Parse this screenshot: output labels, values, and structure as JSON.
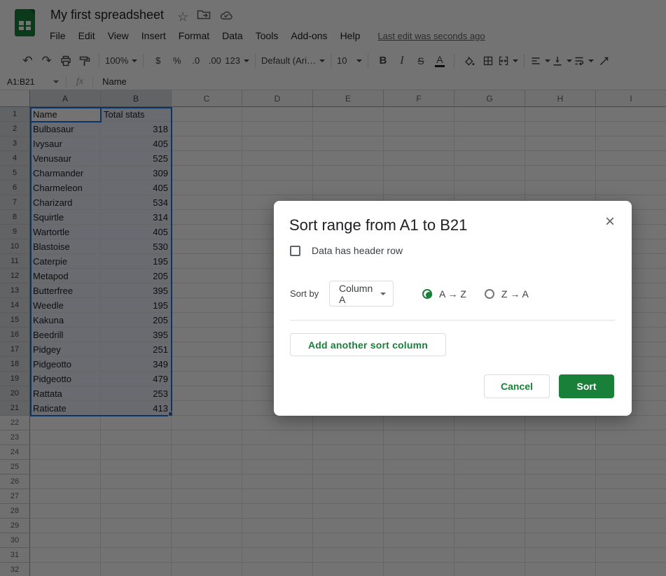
{
  "titlebar": {
    "title": "My first spreadsheet",
    "star_icon": "☆",
    "menu": [
      "File",
      "Edit",
      "View",
      "Insert",
      "Format",
      "Data",
      "Tools",
      "Add-ons",
      "Help"
    ],
    "last_edit": "Last edit was seconds ago"
  },
  "toolbar": {
    "undo": "↶",
    "redo": "↷",
    "zoom_value": "100%",
    "currency": "$",
    "percent": "%",
    "decrease_decimal": ".0",
    "increase_decimal": ".00",
    "number_format": "123",
    "font_name": "Default (Ari…",
    "font_size": "10",
    "bold": "B",
    "italic": "I",
    "strikethrough": "S",
    "text_color": "A"
  },
  "formula_bar": {
    "name_box_value": "A1:B21",
    "fx_label": "fx",
    "input_value": "Name"
  },
  "sheet": {
    "column_headers": [
      "A",
      "B",
      "C",
      "D",
      "E",
      "F",
      "G",
      "H",
      "I"
    ],
    "visible_row_count": 32,
    "selected_range": "A1:B21",
    "active_cell": "A1",
    "data": {
      "headers_row": [
        "Name",
        "Total stats"
      ],
      "rows": [
        [
          "Bulbasaur",
          318
        ],
        [
          "Ivysaur",
          405
        ],
        [
          "Venusaur",
          525
        ],
        [
          "Charmander",
          309
        ],
        [
          "Charmeleon",
          405
        ],
        [
          "Charizard",
          534
        ],
        [
          "Squirtle",
          314
        ],
        [
          "Wartortle",
          405
        ],
        [
          "Blastoise",
          530
        ],
        [
          "Caterpie",
          195
        ],
        [
          "Metapod",
          205
        ],
        [
          "Butterfree",
          395
        ],
        [
          "Weedle",
          195
        ],
        [
          "Kakuna",
          205
        ],
        [
          "Beedrill",
          395
        ],
        [
          "Pidgey",
          251
        ],
        [
          "Pidgeotto",
          349
        ],
        [
          "Pidgeotto",
          479
        ],
        [
          "Rattata",
          253
        ],
        [
          "Raticate",
          413
        ]
      ]
    }
  },
  "dialog": {
    "title": "Sort range from A1 to B21",
    "close_icon": "×",
    "header_checkbox": {
      "label": "Data has header row",
      "checked": false
    },
    "sort_by_label": "Sort by",
    "column_dropdown_value": "Column A",
    "order_options": [
      {
        "label": "A → Z",
        "selected": true
      },
      {
        "label": "Z → A",
        "selected": false
      }
    ],
    "add_sort_column_label": "Add another sort column",
    "cancel_label": "Cancel",
    "sort_label": "Sort"
  },
  "colors": {
    "accent_green": "#188038",
    "selection_blue": "#1a73e8",
    "selection_fill": "#e9eef8",
    "scrim": "rgba(0,0,0,0.55)"
  }
}
